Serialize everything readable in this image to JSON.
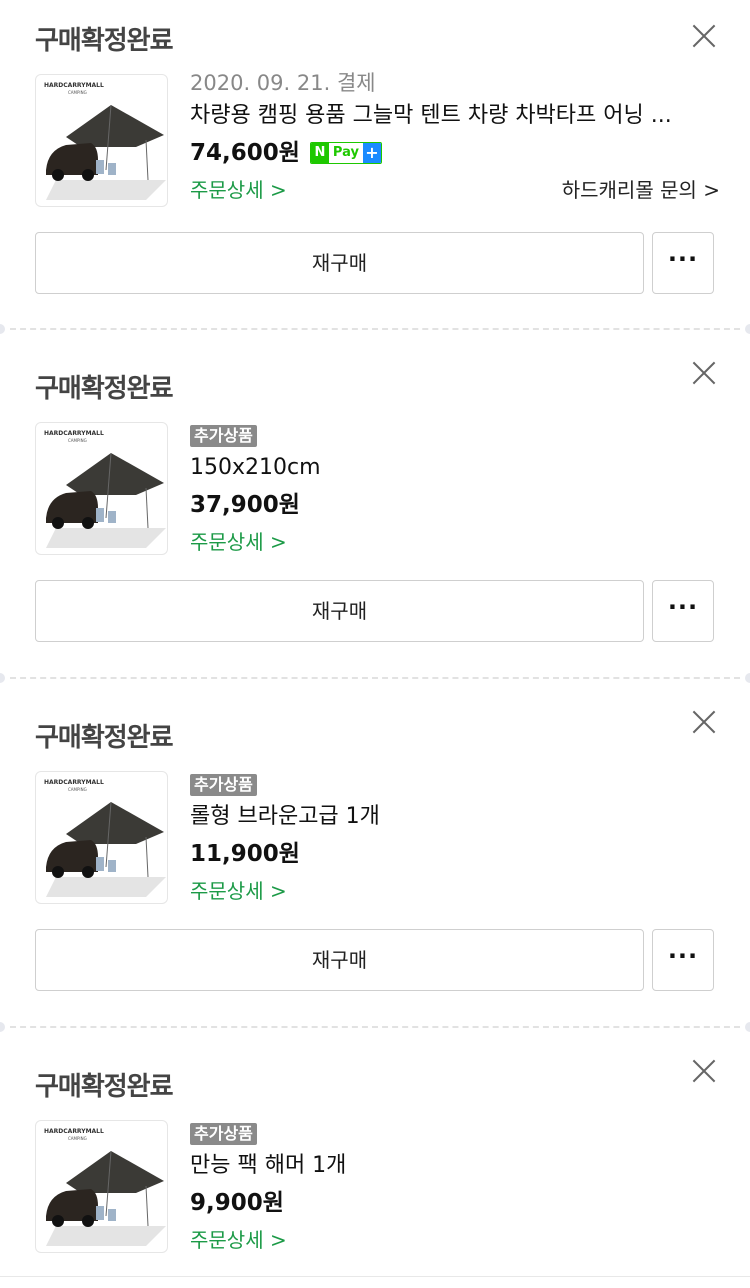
{
  "orders": [
    {
      "status": "구매확정완료",
      "date": "2020. 09. 21. 결제",
      "name": "차량용 캠핑 용품 그늘막 텐트 차량 차박타프 어닝 ...",
      "price": "74,600원",
      "npay": {
        "n": "N",
        "text": "Pay",
        "plus": "+"
      },
      "detail_link": "주문상세 >",
      "seller_link": "하드캐리몰 문의 >",
      "rebuy_label": "재구매",
      "more_label": "···",
      "brand": "HARDCARRYMALL",
      "brand_sub": "CAMPING"
    },
    {
      "status": "구매확정완료",
      "tag": "추가상품",
      "name": "150x210cm",
      "price": "37,900원",
      "detail_link": "주문상세 >",
      "rebuy_label": "재구매",
      "more_label": "···",
      "brand": "HARDCARRYMALL",
      "brand_sub": "CAMPING"
    },
    {
      "status": "구매확정완료",
      "tag": "추가상품",
      "name": "롤형 브라운고급 1개",
      "price": "11,900원",
      "detail_link": "주문상세 >",
      "rebuy_label": "재구매",
      "more_label": "···",
      "brand": "HARDCARRYMALL",
      "brand_sub": "CAMPING"
    },
    {
      "status": "구매확정완료",
      "tag": "추가상품",
      "name": "만능 팩 해머 1개",
      "price": "9,900원",
      "detail_link": "주문상세 >",
      "brand": "HARDCARRYMALL",
      "brand_sub": "CAMPING"
    }
  ],
  "colors": {
    "link_green": "#1c9a47",
    "npay_green": "#1ec800",
    "npay_blue": "#1b8bff",
    "tag_gray": "#8a8a8a"
  }
}
